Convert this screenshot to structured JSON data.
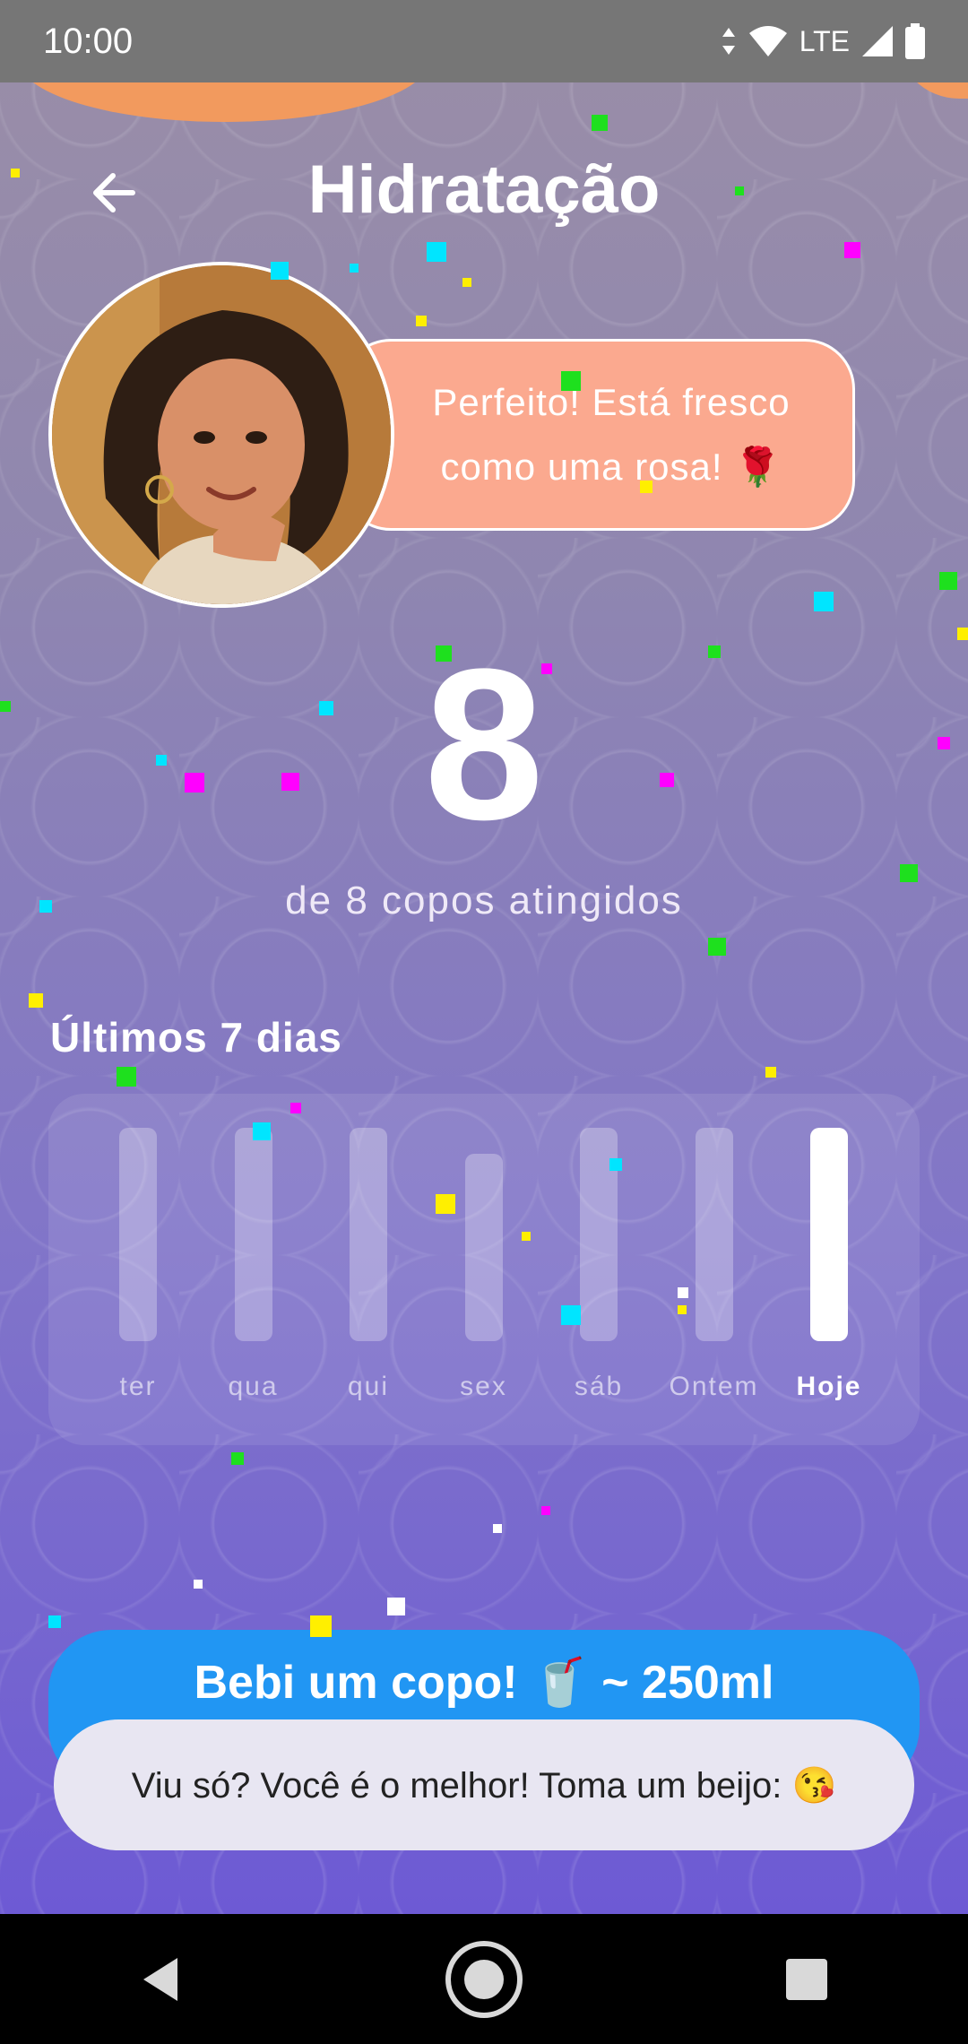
{
  "status_bar": {
    "time": "10:00",
    "network": "LTE",
    "icons": [
      "data-arrows-icon",
      "wifi-icon",
      "signal-icon",
      "battery-icon"
    ]
  },
  "header": {
    "title": "Hidratação",
    "back_icon": "arrow-left-icon"
  },
  "companion": {
    "message": "Perfeito! Está fresco como uma rosa! 🌹"
  },
  "progress": {
    "current": "8",
    "goal_text": "de 8 copos atingidos",
    "current_value": 8,
    "goal_value": 8
  },
  "history": {
    "title": "Últimos 7 dias",
    "days": [
      {
        "label": "ter",
        "fill": 1.0
      },
      {
        "label": "qua",
        "fill": 1.0
      },
      {
        "label": "qui",
        "fill": 1.0
      },
      {
        "label": "sex",
        "fill": 0.88
      },
      {
        "label": "sáb",
        "fill": 1.0
      },
      {
        "label": "Ontem",
        "fill": 1.0
      },
      {
        "label": "Hoje",
        "fill": 1.0,
        "highlight": true
      }
    ]
  },
  "cta": {
    "label": "Bebi um copo! 🥤 ~ 250ml"
  },
  "toast": {
    "message": "Viu só? Você é o melhor! Toma um beijo: 😘"
  },
  "colors": {
    "accent": "#2196f3",
    "bubble": "#fba98f",
    "orange": "#f29a5e"
  }
}
